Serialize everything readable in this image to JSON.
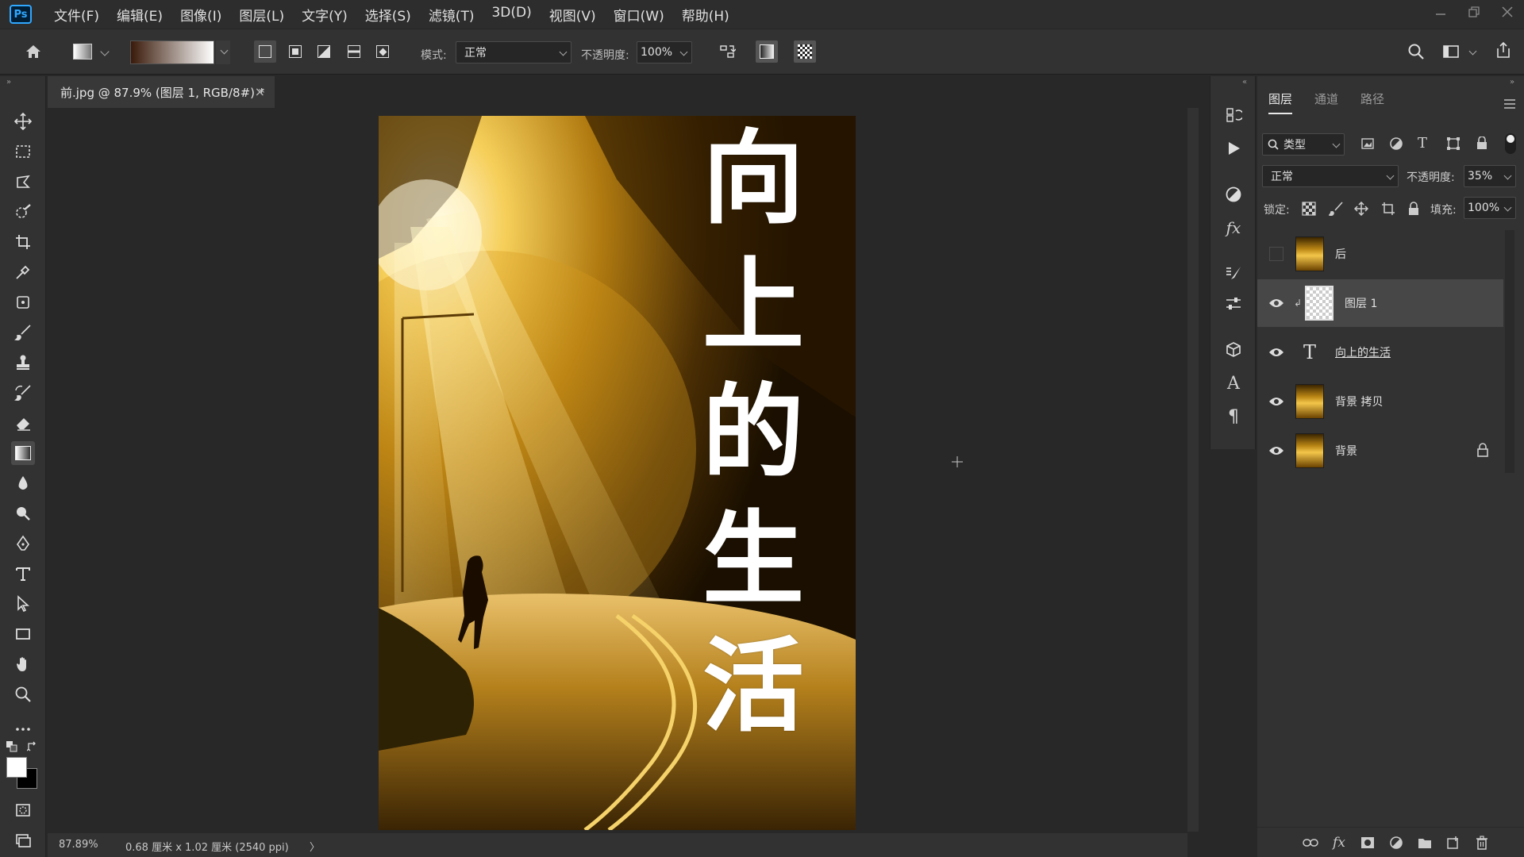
{
  "app": {
    "logo": "Ps"
  },
  "menu": [
    "文件(F)",
    "编辑(E)",
    "图像(I)",
    "图层(L)",
    "文字(Y)",
    "选择(S)",
    "滤镜(T)",
    "3D(D)",
    "视图(V)",
    "窗口(W)",
    "帮助(H)"
  ],
  "options": {
    "mode_label": "模式:",
    "mode_value": "正常",
    "opacity_label": "不透明度:",
    "opacity_value": "100%"
  },
  "document": {
    "tab_title": "前.jpg @ 87.9% (图层 1, RGB/8#) *",
    "close_glyph": "×",
    "artwork_text": [
      "向",
      "上",
      "的",
      "生",
      "活"
    ]
  },
  "status": {
    "zoom": "87.89%",
    "doc_info": "0.68 厘米 x 1.02 厘米 (2540 ppi)",
    "more": "〉"
  },
  "layers_panel": {
    "tabs": [
      "图层",
      "通道",
      "路径"
    ],
    "filter_label": "类型",
    "blend_mode": "正常",
    "opacity_label": "不透明度:",
    "opacity_value": "35%",
    "lock_label": "锁定:",
    "fill_label": "填充:",
    "fill_value": "100%",
    "layers": [
      {
        "name": "后",
        "visible": false,
        "type": "image",
        "selected": false,
        "locked": false
      },
      {
        "name": "图层 1",
        "visible": true,
        "type": "transparent",
        "selected": true,
        "locked": false,
        "clipped": true
      },
      {
        "name": "向上的生活",
        "visible": true,
        "type": "text",
        "selected": false,
        "locked": false
      },
      {
        "name": "背景 拷贝",
        "visible": true,
        "type": "image",
        "selected": false,
        "locked": false
      },
      {
        "name": "背景",
        "visible": true,
        "type": "image",
        "selected": false,
        "locked": true
      }
    ],
    "text_layer_icon": "T"
  },
  "colors": {
    "accent": "#31a8ff",
    "foreground": "#ffffff",
    "background": "#000000"
  },
  "icons": {
    "toolbar": [
      "move-icon",
      "marquee-icon",
      "lasso-icon",
      "quick-select-icon",
      "crop-icon",
      "eyedropper-icon",
      "healing-icon",
      "brush-icon",
      "stamp-icon",
      "history-brush-icon",
      "eraser-icon",
      "gradient-icon",
      "blur-icon",
      "dodge-icon",
      "pen-icon",
      "type-icon",
      "path-select-icon",
      "rectangle-icon",
      "hand-icon",
      "zoom-icon",
      "more-icon"
    ]
  }
}
